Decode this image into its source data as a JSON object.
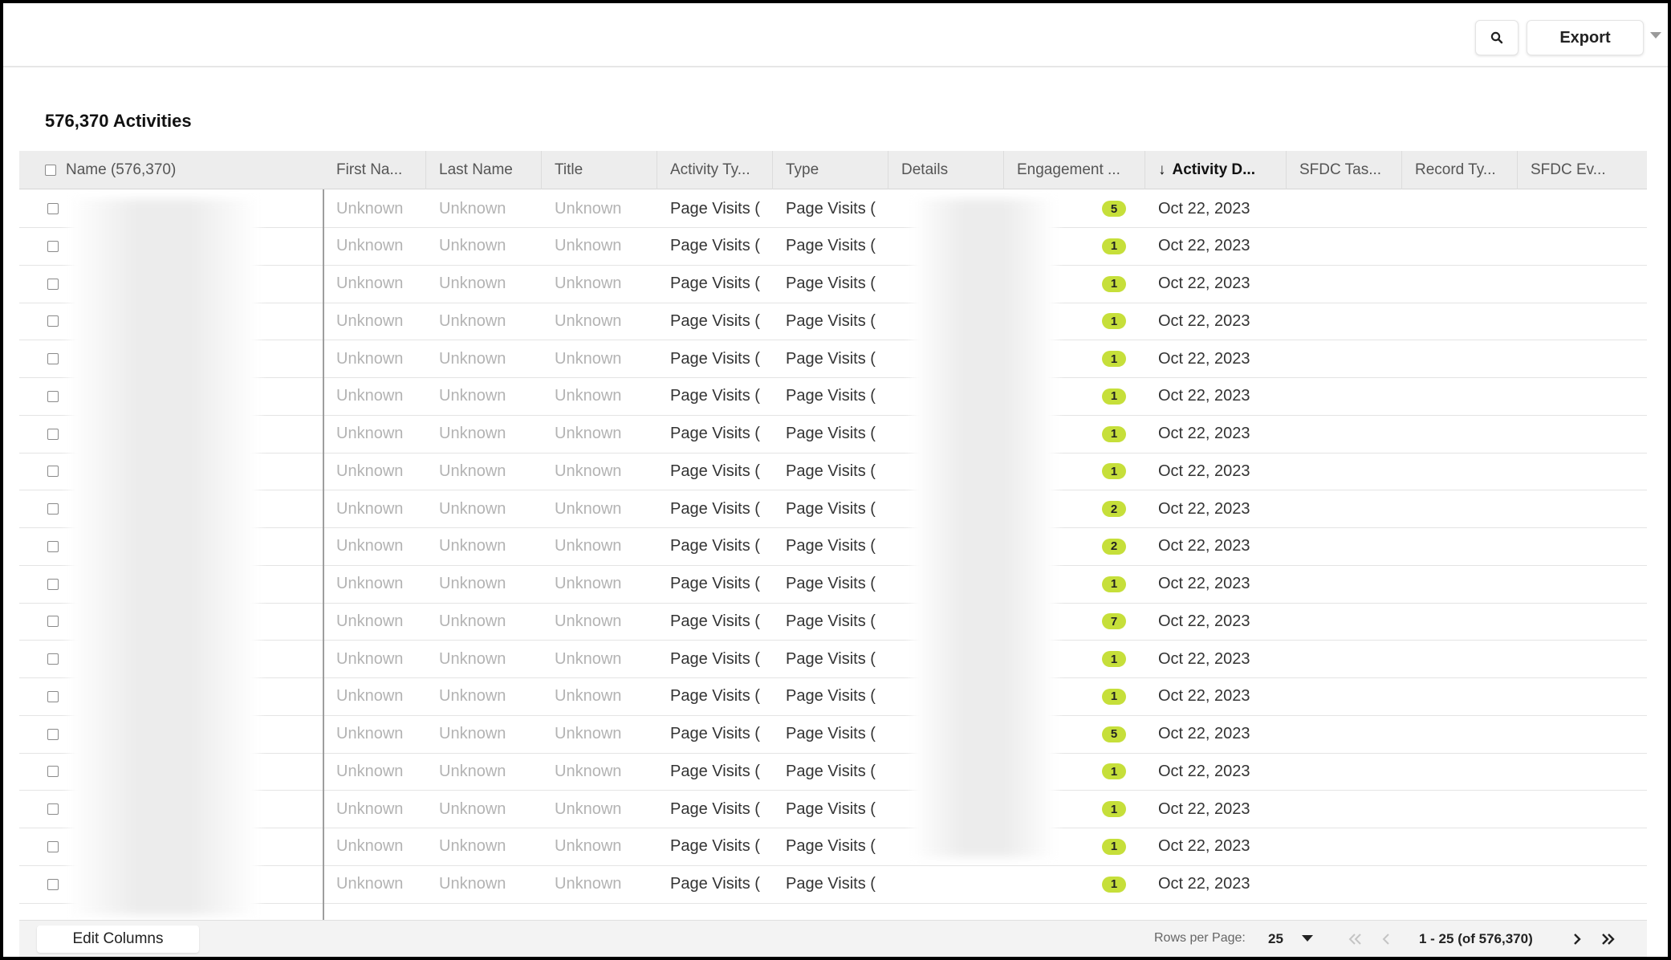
{
  "toolbar": {
    "search_icon": "search-icon",
    "export_label": "Export"
  },
  "title": "576,370 Activities",
  "columns": [
    "Name (576,370)",
    "First Na...",
    "Last Name",
    "Title",
    "Activity Ty...",
    "Type",
    "Details",
    "Engagement ...",
    "Activity D...",
    "SFDC Tas...",
    "Record Ty...",
    "SFDC Ev..."
  ],
  "sorted_column": "Activity D...",
  "sort_direction": "descending",
  "rows": [
    {
      "first": "Unknown",
      "last": "Unknown",
      "title": "Unknown",
      "activity_type": "Page Visits (",
      "type": "Page Visits (",
      "engagement": "5",
      "date": "Oct 22, 2023"
    },
    {
      "first": "Unknown",
      "last": "Unknown",
      "title": "Unknown",
      "activity_type": "Page Visits (",
      "type": "Page Visits (",
      "engagement": "1",
      "date": "Oct 22, 2023"
    },
    {
      "first": "Unknown",
      "last": "Unknown",
      "title": "Unknown",
      "activity_type": "Page Visits (",
      "type": "Page Visits (",
      "engagement": "1",
      "date": "Oct 22, 2023"
    },
    {
      "first": "Unknown",
      "last": "Unknown",
      "title": "Unknown",
      "activity_type": "Page Visits (",
      "type": "Page Visits (",
      "engagement": "1",
      "date": "Oct 22, 2023"
    },
    {
      "first": "Unknown",
      "last": "Unknown",
      "title": "Unknown",
      "activity_type": "Page Visits (",
      "type": "Page Visits (",
      "engagement": "1",
      "date": "Oct 22, 2023"
    },
    {
      "first": "Unknown",
      "last": "Unknown",
      "title": "Unknown",
      "activity_type": "Page Visits (",
      "type": "Page Visits (",
      "engagement": "1",
      "date": "Oct 22, 2023"
    },
    {
      "first": "Unknown",
      "last": "Unknown",
      "title": "Unknown",
      "activity_type": "Page Visits (",
      "type": "Page Visits (",
      "engagement": "1",
      "date": "Oct 22, 2023"
    },
    {
      "first": "Unknown",
      "last": "Unknown",
      "title": "Unknown",
      "activity_type": "Page Visits (",
      "type": "Page Visits (",
      "engagement": "1",
      "date": "Oct 22, 2023"
    },
    {
      "first": "Unknown",
      "last": "Unknown",
      "title": "Unknown",
      "activity_type": "Page Visits (",
      "type": "Page Visits (",
      "engagement": "2",
      "date": "Oct 22, 2023"
    },
    {
      "first": "Unknown",
      "last": "Unknown",
      "title": "Unknown",
      "activity_type": "Page Visits (",
      "type": "Page Visits (",
      "engagement": "2",
      "date": "Oct 22, 2023"
    },
    {
      "first": "Unknown",
      "last": "Unknown",
      "title": "Unknown",
      "activity_type": "Page Visits (",
      "type": "Page Visits (",
      "engagement": "1",
      "date": "Oct 22, 2023"
    },
    {
      "first": "Unknown",
      "last": "Unknown",
      "title": "Unknown",
      "activity_type": "Page Visits (",
      "type": "Page Visits (",
      "engagement": "7",
      "date": "Oct 22, 2023"
    },
    {
      "first": "Unknown",
      "last": "Unknown",
      "title": "Unknown",
      "activity_type": "Page Visits (",
      "type": "Page Visits (",
      "engagement": "1",
      "date": "Oct 22, 2023"
    },
    {
      "first": "Unknown",
      "last": "Unknown",
      "title": "Unknown",
      "activity_type": "Page Visits (",
      "type": "Page Visits (",
      "engagement": "1",
      "date": "Oct 22, 2023"
    },
    {
      "first": "Unknown",
      "last": "Unknown",
      "title": "Unknown",
      "activity_type": "Page Visits (",
      "type": "Page Visits (",
      "engagement": "5",
      "date": "Oct 22, 2023"
    },
    {
      "first": "Unknown",
      "last": "Unknown",
      "title": "Unknown",
      "activity_type": "Page Visits (",
      "type": "Page Visits (",
      "engagement": "1",
      "date": "Oct 22, 2023"
    },
    {
      "first": "Unknown",
      "last": "Unknown",
      "title": "Unknown",
      "activity_type": "Page Visits (",
      "type": "Page Visits (",
      "engagement": "1",
      "date": "Oct 22, 2023"
    },
    {
      "first": "Unknown",
      "last": "Unknown",
      "title": "Unknown",
      "activity_type": "Page Visits (",
      "type": "Page Visits (",
      "engagement": "1",
      "date": "Oct 22, 2023"
    },
    {
      "first": "Unknown",
      "last": "Unknown",
      "title": "Unknown",
      "activity_type": "Page Visits (",
      "type": "Page Visits (",
      "engagement": "1",
      "date": "Oct 22, 2023"
    }
  ],
  "footer": {
    "edit_columns_label": "Edit Columns",
    "rows_per_page_label": "Rows per Page:",
    "rows_per_page_value": "25",
    "range_label": "1 - 25 (of 576,370)"
  },
  "colors": {
    "badge": "#c6df3a",
    "header_bg": "#ededed",
    "muted_text": "#b3b3b3"
  }
}
